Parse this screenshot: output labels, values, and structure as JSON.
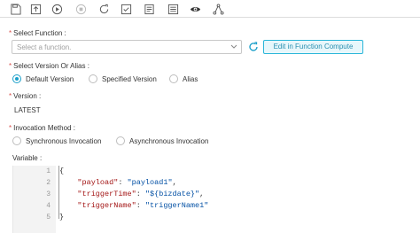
{
  "toolbar": {
    "icons": [
      "save-icon",
      "upload-icon",
      "play-icon",
      "stop-icon",
      "redo-icon",
      "checklist-icon",
      "log-icon",
      "list-icon",
      "eye-icon",
      "share-icon"
    ]
  },
  "form": {
    "function_label": "Select Function :",
    "function_placeholder": "Select a function.",
    "edit_button": "Edit in Function Compute",
    "version_label": "Select Version Or Alias :",
    "version_options": [
      "Default Version",
      "Specified Version",
      "Alias"
    ],
    "version_selected": "Default Version",
    "version_display_label": "Version :",
    "version_value": "LATEST",
    "invocation_label": "Invocation Method :",
    "invocation_options": [
      "Synchronous Invocation",
      "Asynchronous Invocation"
    ],
    "variable_label": "Variable :"
  },
  "editor": {
    "line_numbers": [
      "1",
      "2",
      "3",
      "4",
      "5"
    ],
    "lines": [
      {
        "brace": "{"
      },
      {
        "key": "\"payload\"",
        "sep": ": ",
        "value": "\"payload1\"",
        "end": ","
      },
      {
        "key": "\"triggerTime\"",
        "sep": ": ",
        "value": "\"${bizdate}\"",
        "end": ","
      },
      {
        "key": "\"triggerName\"",
        "sep": ": ",
        "value": "\"triggerName1\"",
        "end": ""
      },
      {
        "brace": "}"
      }
    ]
  },
  "colors": {
    "accent": "#1a9fc9",
    "required": "#d9534f",
    "json_key": "#a31515",
    "json_string": "#0451a5"
  }
}
